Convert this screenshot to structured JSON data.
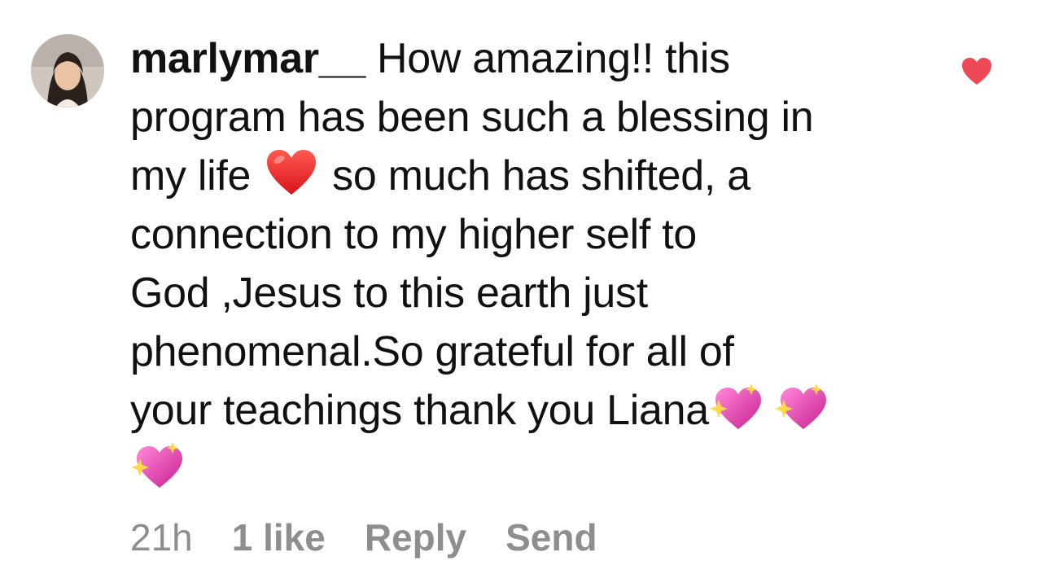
{
  "comment": {
    "username": "marlymar__",
    "lines": [
      "How amazing!! this",
      "program has been such a blessing in",
      "my life",
      "so much has shifted, a",
      "connection to my higher self to",
      "God ,Jesus to this earth just",
      "phenomenal.So grateful for all of",
      "your teachings thank you Liana"
    ],
    "emojis": {
      "red_heart": "red-heart-emoji",
      "sparkling_heart": "sparkling-heart-emoji"
    },
    "liked": true
  },
  "meta": {
    "time": "21h",
    "likes": "1 like",
    "reply_label": "Reply",
    "send_label": "Send"
  },
  "colors": {
    "text": "#111111",
    "meta": "#8e8e8e",
    "like": "#ed4956"
  }
}
